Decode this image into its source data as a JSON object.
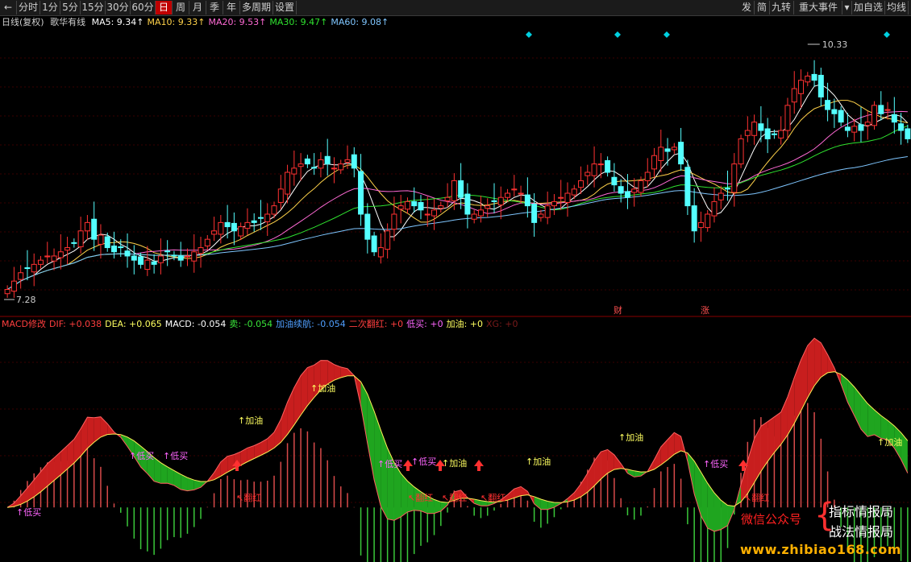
{
  "toolbar": {
    "period_buttons": [
      "分时",
      "1分",
      "5分",
      "15分",
      "30分",
      "60分",
      "日",
      "周",
      "月",
      "季",
      "年",
      "多周期",
      "设置"
    ],
    "active_period": "日",
    "right_buttons": [
      "发",
      "简",
      "九转",
      "重大事件",
      "加自选",
      "均线"
    ]
  },
  "main_info": {
    "period_label": "日线(复权)",
    "indicator_name": "歌华有线",
    "ma": [
      {
        "text": "MA5: 9.34",
        "color": "#ffffff"
      },
      {
        "text": "MA10: 9.33",
        "color": "#ffd24a"
      },
      {
        "text": "MA20: 9.53",
        "color": "#ff6ad5"
      },
      {
        "text": "MA30: 9.47",
        "color": "#2fe32f"
      },
      {
        "text": "MA60: 9.08",
        "color": "#7fc6ff"
      }
    ],
    "high_label": "10.33",
    "low_label": "7.28",
    "event_tags": [
      "财",
      "涨"
    ]
  },
  "macd_info": {
    "segments": [
      {
        "text": "MACD修改",
        "color": "#ff3e3e"
      },
      {
        "text": "DIF: +0.038",
        "color": "#ff3e3e"
      },
      {
        "text": "DEA: +0.065",
        "color": "#ffff60"
      },
      {
        "text": "MACD: -0.054",
        "color": "#ffffff"
      },
      {
        "text": "卖: -0.054",
        "color": "#39e639"
      },
      {
        "text": "加油续航: -0.054",
        "color": "#4f9fff"
      },
      {
        "text": "二次翻红: +0",
        "color": "#ff3e3e"
      },
      {
        "text": "低买: +0",
        "color": "#ff66ff"
      },
      {
        "text": "加油: +0",
        "color": "#ffff60"
      },
      {
        "text": "XG: +0",
        "color": "#7a1a1a"
      }
    ]
  },
  "signals": {
    "low_buy": "低买",
    "add_fuel": "加油",
    "turn_red": "翻红"
  },
  "watermark": {
    "wechat": "微信公众号",
    "line1": "指标情报局",
    "line2": "战法情报局",
    "site": "www.zhibiao168.com"
  },
  "chart_data": {
    "type": "candlestick",
    "stock": "歌华有线",
    "price_range": [
      7.28,
      10.33
    ],
    "close": [
      7.4,
      7.5,
      7.6,
      7.65,
      7.7,
      7.75,
      7.8,
      7.8,
      7.85,
      7.9,
      7.95,
      8.1,
      8.2,
      8.0,
      8.05,
      7.9,
      7.85,
      7.9,
      7.8,
      7.75,
      7.7,
      7.75,
      7.7,
      7.8,
      7.85,
      7.8,
      7.75,
      7.8,
      7.85,
      7.9,
      8.0,
      8.1,
      8.2,
      8.15,
      8.1,
      8.15,
      8.2,
      8.2,
      8.25,
      8.3,
      8.4,
      8.6,
      8.8,
      8.85,
      8.9,
      8.9,
      8.85,
      8.95,
      8.9,
      8.85,
      8.9,
      8.95,
      8.85,
      8.3,
      8.0,
      7.85,
      7.9,
      8.1,
      8.3,
      8.4,
      8.45,
      8.4,
      8.35,
      8.3,
      8.35,
      8.4,
      8.5,
      8.7,
      8.5,
      8.3,
      8.3,
      8.35,
      8.4,
      8.45,
      8.5,
      8.55,
      8.6,
      8.55,
      8.4,
      8.2,
      8.3,
      8.4,
      8.45,
      8.5,
      8.55,
      8.6,
      8.7,
      8.8,
      8.9,
      8.9,
      8.8,
      8.65,
      8.55,
      8.5,
      8.6,
      8.7,
      8.8,
      9.0,
      9.1,
      9.05,
      9.1,
      8.9,
      8.4,
      8.1,
      8.2,
      8.3,
      8.45,
      8.55,
      8.6,
      8.9,
      9.2,
      9.3,
      9.4,
      9.3,
      9.2,
      9.25,
      9.3,
      9.6,
      9.8,
      9.9,
      9.95,
      9.9,
      9.7,
      9.55,
      9.5,
      9.4,
      9.3,
      9.35,
      9.3,
      9.4,
      9.6,
      9.5,
      9.55,
      9.4,
      9.3,
      9.2
    ],
    "indicators": {
      "MA5": 9.34,
      "MA10": 9.33,
      "MA20": 9.53,
      "MA30": 9.47,
      "MA60": 9.08
    },
    "macd": {
      "DIF": 0.038,
      "DEA": 0.065,
      "MACD": -0.054
    }
  }
}
